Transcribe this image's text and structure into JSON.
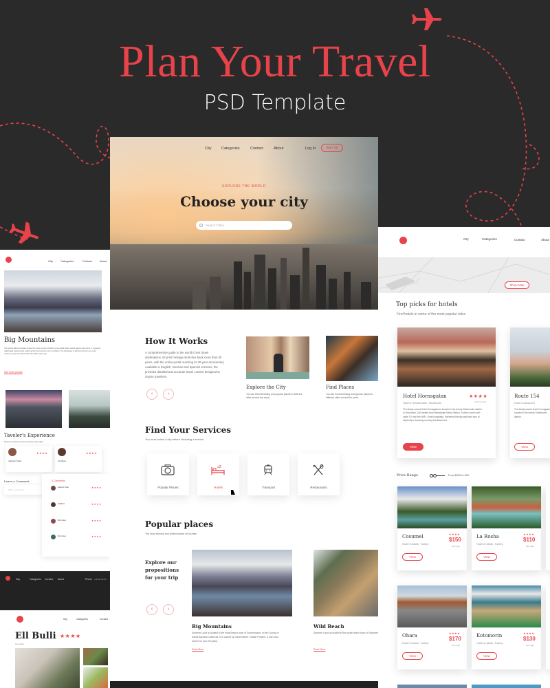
{
  "banner": {
    "title": "Plan Your Travel",
    "subtitle": "PSD Template",
    "accent_color": "#e8434a",
    "background_color": "#2a2a2a"
  },
  "main_mockup": {
    "nav": [
      "City",
      "Categories",
      "Contact",
      "About"
    ],
    "login": "Log In",
    "signup": "Sign Up",
    "hero": {
      "eyebrow": "EXPLORE THE WORLD",
      "title": "Choose your city",
      "search_placeholder": "Search Cities"
    },
    "how_it_works": {
      "title": "How It Works",
      "text": "A comprehensive guide to the world's best travel destinations, its print heritage stretches back more than 30 years, with the online portal reaching its 20-year anniversary. Available in English, German and Spanish versions, the provides detailed and accurate travel content designed to inspire travellers.",
      "cards": [
        {
          "title": "Explore the City",
          "text": "You can find interesting and popular places in different cities around the world."
        },
        {
          "title": "Find Places",
          "text": "You can find interesting and popular places in different cities around the world."
        }
      ]
    },
    "services": {
      "title": "Find Your Services",
      "subtitle": "You must select a city before choosing a service",
      "items": [
        {
          "label": "Popular Places",
          "icon": "camera-icon"
        },
        {
          "label": "Hotels",
          "icon": "bed-icon"
        },
        {
          "label": "Transport",
          "icon": "train-icon"
        },
        {
          "label": "Restaurants",
          "icon": "cutlery-icon"
        }
      ]
    },
    "popular": {
      "title": "Popular places",
      "subtitle": "The most famous and visited places for tourists",
      "side_heading": "Explore our propositions for your trip",
      "places": [
        {
          "title": "Big Mountains",
          "text": "Summer Land is located in the small beach town of Summerland, in the County of Santa Barbara California. It is owned by horse trainer Charlie Powers, a rider and trainer for over 25 years.",
          "link": "Read More"
        },
        {
          "title": "Wild Beach",
          "text": "Summer Land is located in the small beach town of Summerland, in the County of Santa Barbara California. It is owned by horse trainer Charlie Powers, a rider and trainer for over 25 years.",
          "link": "Read More"
        }
      ]
    }
  },
  "left_mockup": {
    "nav": [
      "City",
      "Categories",
      "Contact",
      "About"
    ],
    "article_title": "Big Mountains",
    "article_text": "The world's tallest mountain ranges form when pieces of Earth's crust called plates smash against each other in a process called plate tectonics and buckle up like the hood of a car in a collision. The Himalayas in Asia formed from one such massive wreck that started about 55 million years ago.",
    "article_link": "See more photos",
    "experience_title": "Taveler's Experience",
    "experience_subtitle": "People are their comments about the place",
    "reviewers": [
      {
        "name": "Jackson Fuller",
        "rating": 4
      },
      {
        "name": "Lily Bess",
        "rating": 4
      }
    ],
    "comment_title": "Leave a Comment",
    "comment_placeholder": "Write a comment",
    "comments_header": "4 Comments",
    "comments": [
      {
        "name": "Jackson Fuller",
        "rating": 4
      },
      {
        "name": "Lily Bess",
        "rating": 4
      },
      {
        "name": "Bob Jones",
        "rating": 4
      },
      {
        "name": "Bob Jones",
        "rating": 4
      }
    ],
    "restaurant_nav": [
      "City",
      "Categories",
      "Contact",
      "About"
    ],
    "phone_label": "Phone",
    "phone": "+00 00 00 00",
    "restaurant_title": "Ell Bulli",
    "restaurant_sub": "Sri Lanka",
    "restaurant_rating": 4
  },
  "right_mockup": {
    "nav": [
      "City",
      "Categories",
      "Contact",
      "About"
    ],
    "show_map": "Show Map",
    "top_picks_title": "Top picks for hotels",
    "top_picks_subtitle": "Find hotels in some of the most popular cities",
    "top_hotels": [
      {
        "name": "Hotel Hornsgatan",
        "location": "Hotel in Södermalm, Stockholm",
        "rating": 4,
        "reviews": "1231 reviews",
        "text": "The family-owned Hotel Hornsgatan is located in the trendy Södermalm district in Stockholm, 150 metres from Mariatorget Metro Station. It offers rooms with cable TV and free WiFi. Great hospitality. Extremely friendly staff with tons of helpful tips. Amazing morning breakfast and",
        "button": "View"
      },
      {
        "name": "Route 154",
        "location": "Hotel in Alvaneel",
        "text": "The family-owned Hotel Hornsgatan is located in the trendy Södermalm district...",
        "button": "View"
      }
    ],
    "price_range_label": "Price Range",
    "price_range_value": "From $100 to 500",
    "hotels": [
      {
        "name": "Cosumel",
        "location": "Hotel in Mulin, Turkey",
        "price": "$150",
        "per": "Per night",
        "rating": 4,
        "button": "View"
      },
      {
        "name": "La Rosha",
        "location": "Hotel in Mulin, Turkey",
        "price": "$110",
        "per": "Per night",
        "rating": 4,
        "button": "View"
      },
      {
        "name": "Ohara",
        "location": "Hotel in Mulin, Turkey",
        "price": "$170",
        "per": "Per night",
        "rating": 4,
        "button": "View"
      },
      {
        "name": "Kotomorin",
        "location": "Hotel in Mulin, Turkey",
        "price": "$130",
        "per": "Per night",
        "rating": 4,
        "button": "View"
      }
    ]
  },
  "icons": {
    "star": "★",
    "prev": "‹",
    "next": "›"
  }
}
